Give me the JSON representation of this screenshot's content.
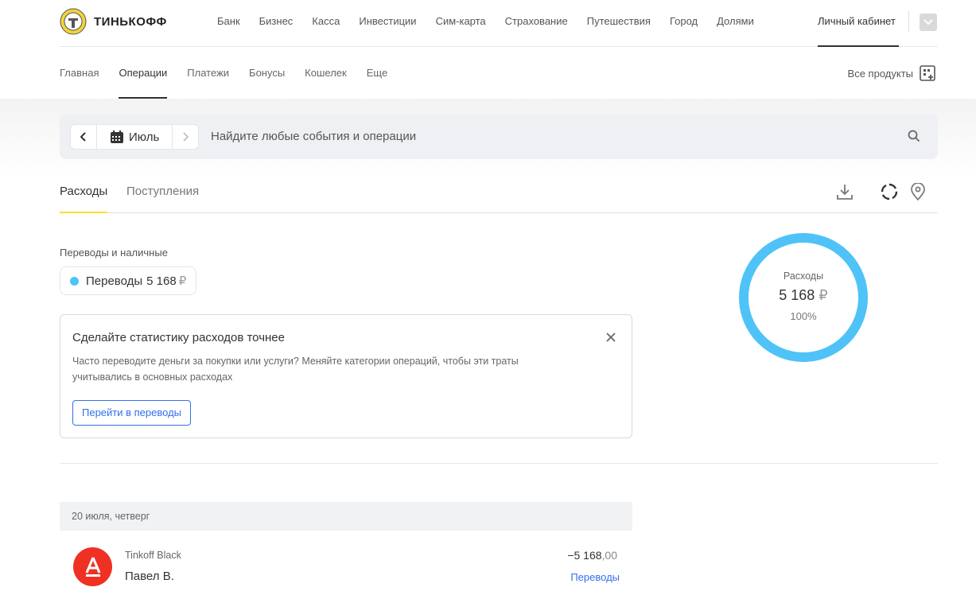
{
  "header": {
    "brand": "ТИНЬКОФФ",
    "nav": [
      "Банк",
      "Бизнес",
      "Касса",
      "Инвестиции",
      "Сим-карта",
      "Страхование",
      "Путешествия",
      "Город",
      "Долями"
    ],
    "cabinet": "Личный кабинет"
  },
  "subnav": {
    "items": [
      "Главная",
      "Операции",
      "Платежи",
      "Бонусы",
      "Кошелек",
      "Еще"
    ],
    "active": "Операции",
    "all_products": "Все продукты"
  },
  "search": {
    "month": "Июль",
    "placeholder": "Найдите любые события и операции"
  },
  "tabs": {
    "expenses": "Расходы",
    "income": "Поступления"
  },
  "category_section": {
    "title": "Переводы и наличные",
    "chip_name": "Переводы",
    "chip_amount": "5 168",
    "currency": "₽",
    "chip_color": "#4fc3f7"
  },
  "tip": {
    "title": "Сделайте статистику расходов точнее",
    "text": "Часто переводите деньги за покупки или услуги? Меняйте категории операций, чтобы эти траты учитывались в основных расходах",
    "button": "Перейти в переводы"
  },
  "donut": {
    "label": "Расходы",
    "amount": "5 168",
    "currency": "₽",
    "percent_label": "100%",
    "percent": 100,
    "color": "#4fc3f7"
  },
  "operations": {
    "date_header": "20 июля, четверг",
    "items": [
      {
        "card": "Tinkoff Black",
        "name": "Павел В.",
        "amount_main": "−5 168",
        "amount_cents": ",00",
        "category": "Переводы",
        "avatar_letter": "А",
        "avatar_color": "#ef3124"
      }
    ]
  }
}
